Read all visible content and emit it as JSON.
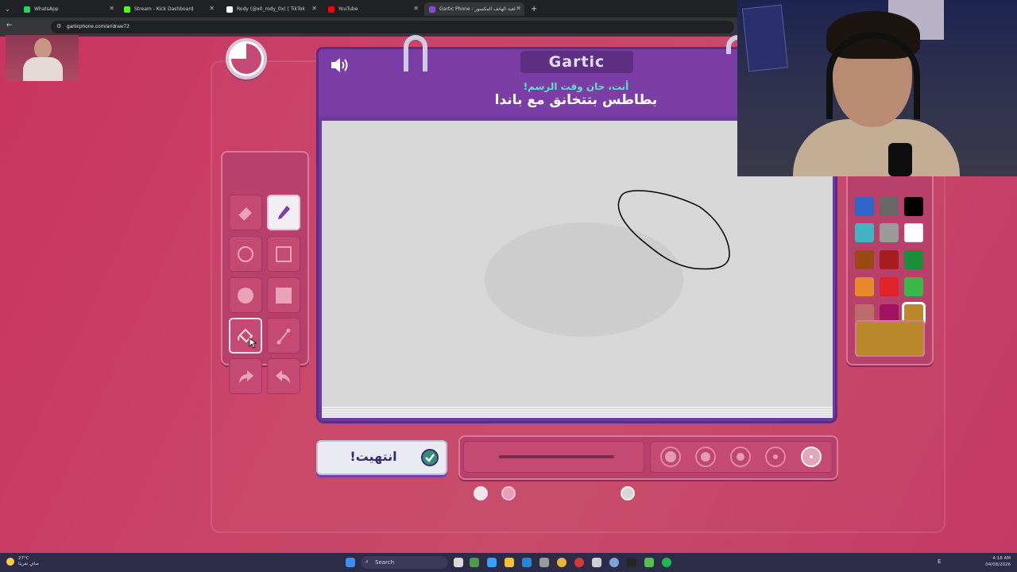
{
  "browser": {
    "tabs": [
      {
        "label": "WhatsApp",
        "color": "#25d366",
        "active": false
      },
      {
        "label": "Stream - Kick Dashboard",
        "color": "#53fc18",
        "active": false
      },
      {
        "label": "Rody (@x0_rody_0x) | TikTok",
        "color": "#ffffff",
        "active": false
      },
      {
        "label": "YouTube",
        "color": "#ff0000",
        "active": false
      },
      {
        "label": "Gartic Phone - لعبة الهاتف المكسور",
        "color": "#8a4bd0",
        "active": true
      }
    ],
    "new_tab": "+",
    "url": "garticphone.com/ar/draw72"
  },
  "game": {
    "brand": "Gartic",
    "prompt_sub": "أنت، حان وقت الرسم!",
    "prompt_main": "بطاطس بتتخانق مع باندا",
    "done_button": "انتهيت!",
    "tools": [
      {
        "name": "eraser-tool",
        "icon": "eraser-icon",
        "selected": false
      },
      {
        "name": "pencil-tool",
        "icon": "pencil-icon",
        "selected": true
      },
      {
        "name": "ellipse-outline-tool",
        "icon": "circle-outline-icon",
        "selected": false
      },
      {
        "name": "rectangle-outline-tool",
        "icon": "square-outline-icon",
        "selected": false
      },
      {
        "name": "ellipse-fill-tool",
        "icon": "circle-fill-icon",
        "selected": false
      },
      {
        "name": "rectangle-fill-tool",
        "icon": "square-fill-icon",
        "selected": false
      },
      {
        "name": "fill-bucket-tool",
        "icon": "bucket-icon",
        "selected": false
      },
      {
        "name": "line-tool",
        "icon": "line-icon",
        "selected": false
      },
      {
        "name": "undo-tool",
        "icon": "undo-icon",
        "selected": false
      },
      {
        "name": "redo-tool",
        "icon": "redo-icon",
        "selected": false
      }
    ],
    "palette": [
      "#2f64c8",
      "#676767",
      "#000000",
      "#46b3c4",
      "#9a9a9a",
      "#ffffff",
      "#9a4a14",
      "#a51d1d",
      "#1d8f3a",
      "#e78a2e",
      "#e0242a",
      "#3cb84a",
      "#bd6b6b",
      "#a11465",
      "#b9892c",
      "#e3b4b4",
      "#e3279c",
      "#e9c23a"
    ],
    "selected_color_index": 14,
    "current_color": "#b9892c",
    "opacity_level": 0.05,
    "brush_sizes_selected": 4
  },
  "taskbar": {
    "weather_temp": "27°C",
    "weather_desc": "صافٍ تقريبًا",
    "search": "Search",
    "time": "4:18 AM",
    "date": "04/08/2026",
    "lang": "E"
  }
}
